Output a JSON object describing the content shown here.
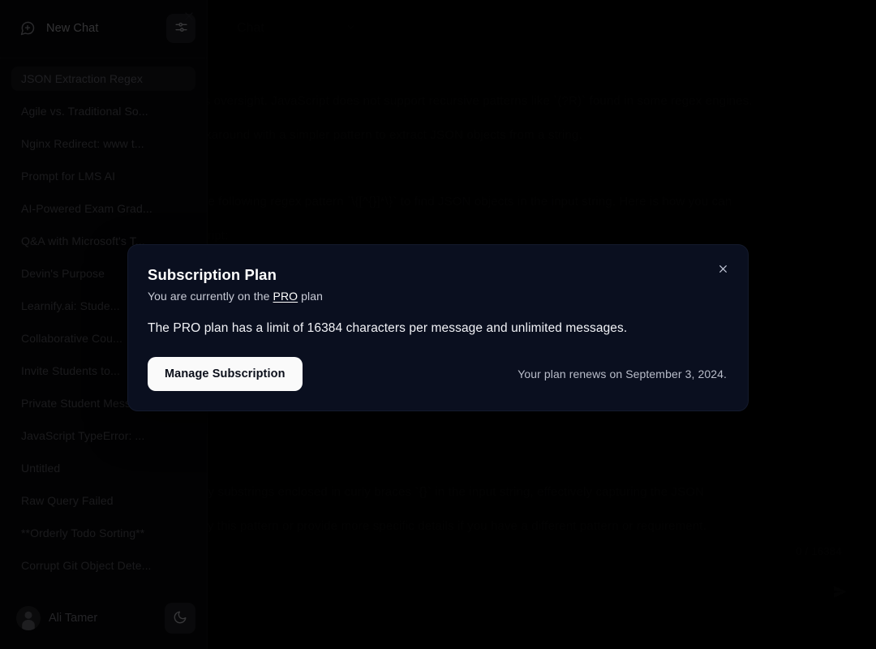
{
  "sidebar": {
    "new_chat_label": "New Chat",
    "new_chat_icon": "message-plus-icon",
    "settings_icon": "sliders-icon",
    "close_icon": "close-icon",
    "chats": [
      {
        "label": "JSON Extraction Regex",
        "active": true
      },
      {
        "label": "Agile vs. Traditional So...",
        "active": false
      },
      {
        "label": "Nginx Redirect: www t...",
        "active": false
      },
      {
        "label": "Prompt for LMS AI",
        "active": false
      },
      {
        "label": "AI-Powered Exam Grad...",
        "active": false
      },
      {
        "label": "Q&A with Microsoft's T...",
        "active": false
      },
      {
        "label": "Devin's Purpose",
        "active": false
      },
      {
        "label": "Learnify.ai: Stude...",
        "active": false
      },
      {
        "label": "Collaborative Cou...",
        "active": false
      },
      {
        "label": "Invite Students to...",
        "active": false
      },
      {
        "label": "Private Student Messa...",
        "active": false
      },
      {
        "label": "JavaScript TypeError: ...",
        "active": false
      },
      {
        "label": "Untitled",
        "active": false
      },
      {
        "label": "Raw Query Failed",
        "active": false
      },
      {
        "label": "**Orderly Todo Sorting**",
        "active": false
      },
      {
        "label": "Corrupt Git Object Dete...",
        "active": false
      }
    ],
    "user_name": "Ali Tamer",
    "avatar_icon": "user-avatar-icon",
    "theme_toggle_icon": "moon-icon"
  },
  "main": {
    "header_title": "Chat",
    "header_chevron_icon": "chevron-down-icon",
    "messages": [
      "is oversight. JavaScript does not support recursive patterns like `(?R)` found in some regex engines.",
      "rkaround with a simpler pattern to extract JSON objects from a string.",
      "he following regex pattern `\\{[^{}]*\\}` to find JSON objects in the input string. Here is how you can",
      "cript:",
      "ny substrings enclosed in curly braces `{}` in the input string, effectively capturing the JSON",
      "ify this pattern or provide more specific details if you have a different pattern or requirement."
    ],
    "char_count": "0 / 16384",
    "send_icon": "send-icon"
  },
  "modal": {
    "title": "Subscription Plan",
    "close_icon": "close-icon",
    "subtitle_prefix": "You are currently on the ",
    "plan_name": "PRO",
    "subtitle_suffix": " plan",
    "body": "The PRO plan has a limit of 16384 characters per message and unlimited messages.",
    "manage_button": "Manage Subscription",
    "renew_text": "Your plan renews on September 3, 2024."
  },
  "colors": {
    "modal_bg": "#0a0f1f",
    "sidebar_bg": "#09090b",
    "page_bg": "#000000",
    "button_primary_bg": "#fafafa",
    "button_primary_text": "#0b0f1a",
    "active_item_bg": "#17171b"
  }
}
